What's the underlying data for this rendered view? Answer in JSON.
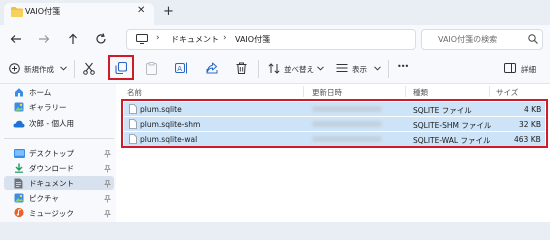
{
  "window": {
    "tab_title": "VAIO付箋",
    "close_glyph": "✕",
    "new_tab_glyph": "+"
  },
  "address_bar": {
    "breadcrumb": [
      "ドキュメント",
      "VAIO付箋"
    ],
    "separator": "›",
    "search_placeholder": "VAIO付箋の検索"
  },
  "command_bar": {
    "new_label": "新規作成",
    "sort_label": "並べ替え",
    "view_label": "表示",
    "more_glyph": "•••",
    "details_label": "詳細",
    "highlighted_action": "copy-icon"
  },
  "sidebar": {
    "items": [
      {
        "label": "ホーム",
        "icon": "home-icon",
        "pinned": false
      },
      {
        "label": "ギャラリー",
        "icon": "gallery-icon",
        "pinned": false
      },
      {
        "label": "次郎 - 個人用",
        "icon": "onedrive-icon",
        "pinned": false
      },
      {
        "label": "デスクトップ",
        "icon": "desktop-icon",
        "pinned": true
      },
      {
        "label": "ダウンロード",
        "icon": "download-icon",
        "pinned": true
      },
      {
        "label": "ドキュメント",
        "icon": "documents-icon",
        "pinned": true,
        "selected": true
      },
      {
        "label": "ピクチャ",
        "icon": "pictures-icon",
        "pinned": true
      },
      {
        "label": "ミュージック",
        "icon": "music-icon",
        "pinned": true
      }
    ],
    "pin_glyph": "📌"
  },
  "file_list": {
    "columns": [
      "名前",
      "更新日時",
      "種類",
      "サイズ"
    ],
    "rows": [
      {
        "name": "plum.sqlite",
        "type": "SQLITE ファイル",
        "size": "4 KB"
      },
      {
        "name": "plum.sqlite-shm",
        "type": "SQLITE-SHM ファイル",
        "size": "32 KB"
      },
      {
        "name": "plum.sqlite-wal",
        "type": "SQLITE-WAL ファイル",
        "size": "463 KB"
      }
    ]
  },
  "colors": {
    "highlight_red": "#d01c26",
    "selection_blue": "#cde3f7",
    "folder_yellow": "#f0c040"
  }
}
